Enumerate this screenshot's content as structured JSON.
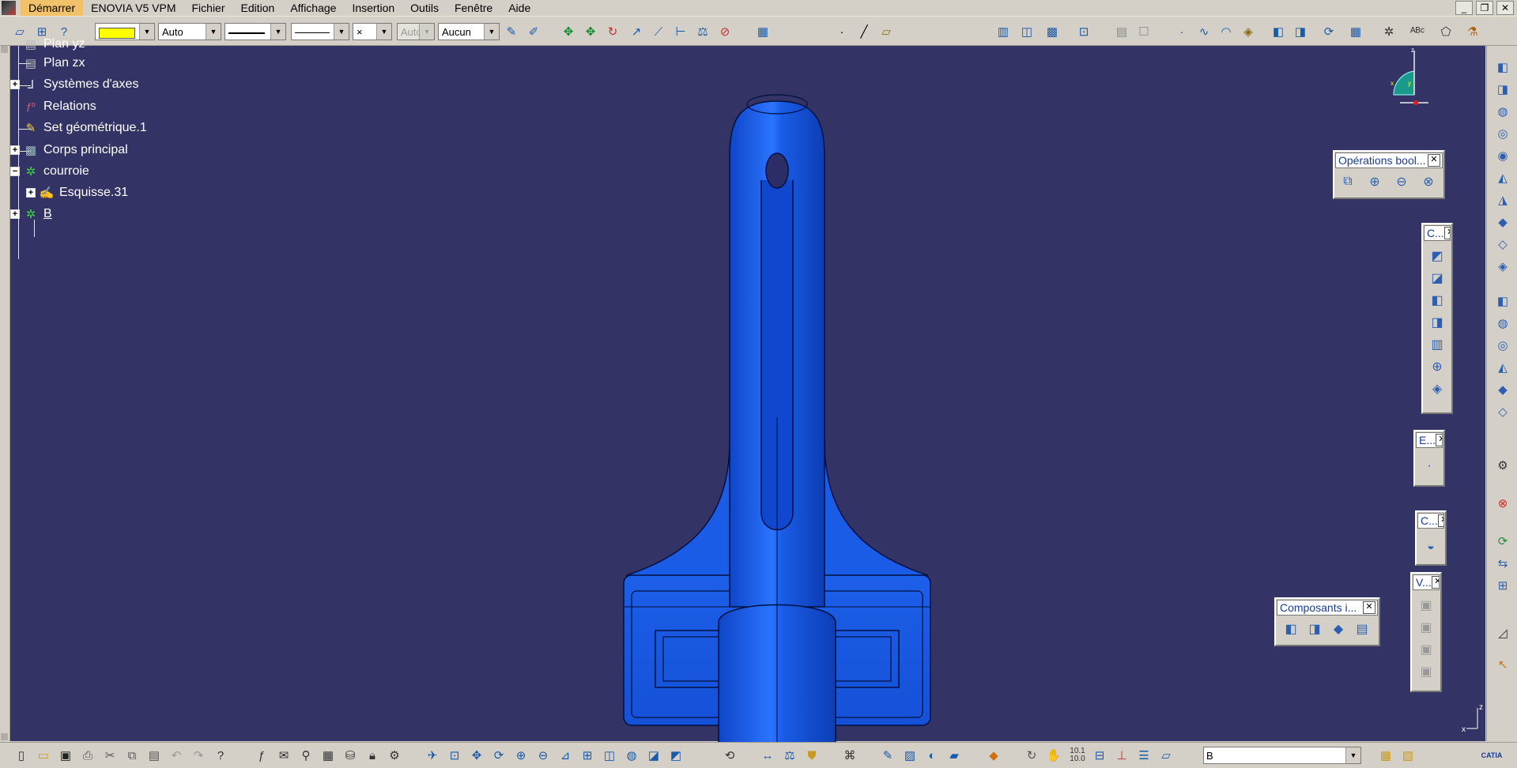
{
  "menu": {
    "items": [
      "Démarrer",
      "ENOVIA V5 VPM",
      "Fichier",
      "Edition",
      "Affichage",
      "Insertion",
      "Outils",
      "Fenêtre",
      "Aide"
    ],
    "window_controls": [
      "_",
      "❐",
      "✕"
    ]
  },
  "toolbar": {
    "color_value": "",
    "transparency": "Auto",
    "linetype_value": "",
    "thickness_value": "",
    "point_symbol": "×",
    "layer_disabled": "Auto",
    "layer": "Aucun"
  },
  "tree": {
    "items": [
      {
        "label": "Plan yz",
        "icon": "plane-icon"
      },
      {
        "label": "Plan zx",
        "icon": "plane-icon"
      },
      {
        "label": "Systèmes d'axes",
        "icon": "axis-system-icon"
      },
      {
        "label": "Relations",
        "icon": "relations-icon"
      },
      {
        "label": "Set géométrique.1",
        "icon": "geometrical-set-icon"
      },
      {
        "label": "Corps principal",
        "icon": "part-body-icon"
      },
      {
        "label": "courroie",
        "icon": "body-icon"
      },
      {
        "label": "Esquisse.31",
        "icon": "sketch-icon"
      },
      {
        "label": "B",
        "icon": "body-icon"
      }
    ]
  },
  "palettes": {
    "boolean_ops": "Opérations bool...",
    "c1": "C...",
    "e1": "E...",
    "c2": "C...",
    "v1": "V...",
    "components": "Composants i..."
  },
  "compass_axes": {
    "z": "z",
    "x": "x",
    "y": "y"
  },
  "view_axes": {
    "z": "z",
    "x": "x"
  },
  "bottom": {
    "command_value": "B",
    "scale_label": "10.1\n10.0",
    "brand": "CATIA"
  },
  "colors": {
    "viewport_bg": "#333366",
    "model_blue": "#1a5ce6",
    "color_swatch": "#ffff00"
  }
}
